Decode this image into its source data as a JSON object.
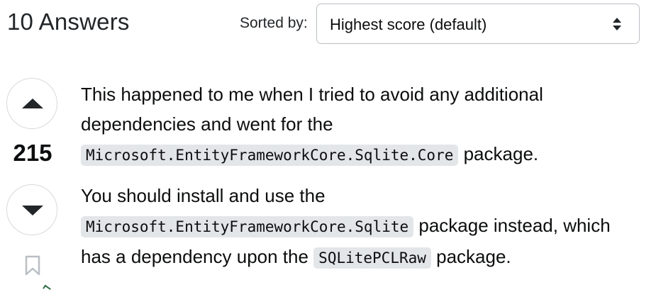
{
  "header": {
    "answers_count": "10 Answers",
    "sort_label": "Sorted by:",
    "sort_value": "Highest score (default)"
  },
  "answer": {
    "score": "215",
    "paragraph1": {
      "text_before": "This happened to me when I tried to avoid any additional dependencies and went for the ",
      "code": "Microsoft.EntityFrameworkCore.Sqlite.Core",
      "text_after": " package."
    },
    "paragraph2": {
      "text_before": "You should install and use the ",
      "code1": "Microsoft.EntityFrameworkCore.Sqlite",
      "text_middle": " package instead, which has a dependency upon the ",
      "code2": "SQLitePCLRaw",
      "text_after": " package."
    }
  },
  "icons": {
    "upvote": "up-arrow-icon",
    "downvote": "down-arrow-icon",
    "bookmark": "bookmark-icon",
    "sort": "sort-arrows-icon"
  },
  "colors": {
    "text": "#0c0d0e",
    "code_bg": "#e3e6e8",
    "border": "#d6d9dc",
    "icon": "#232629"
  }
}
